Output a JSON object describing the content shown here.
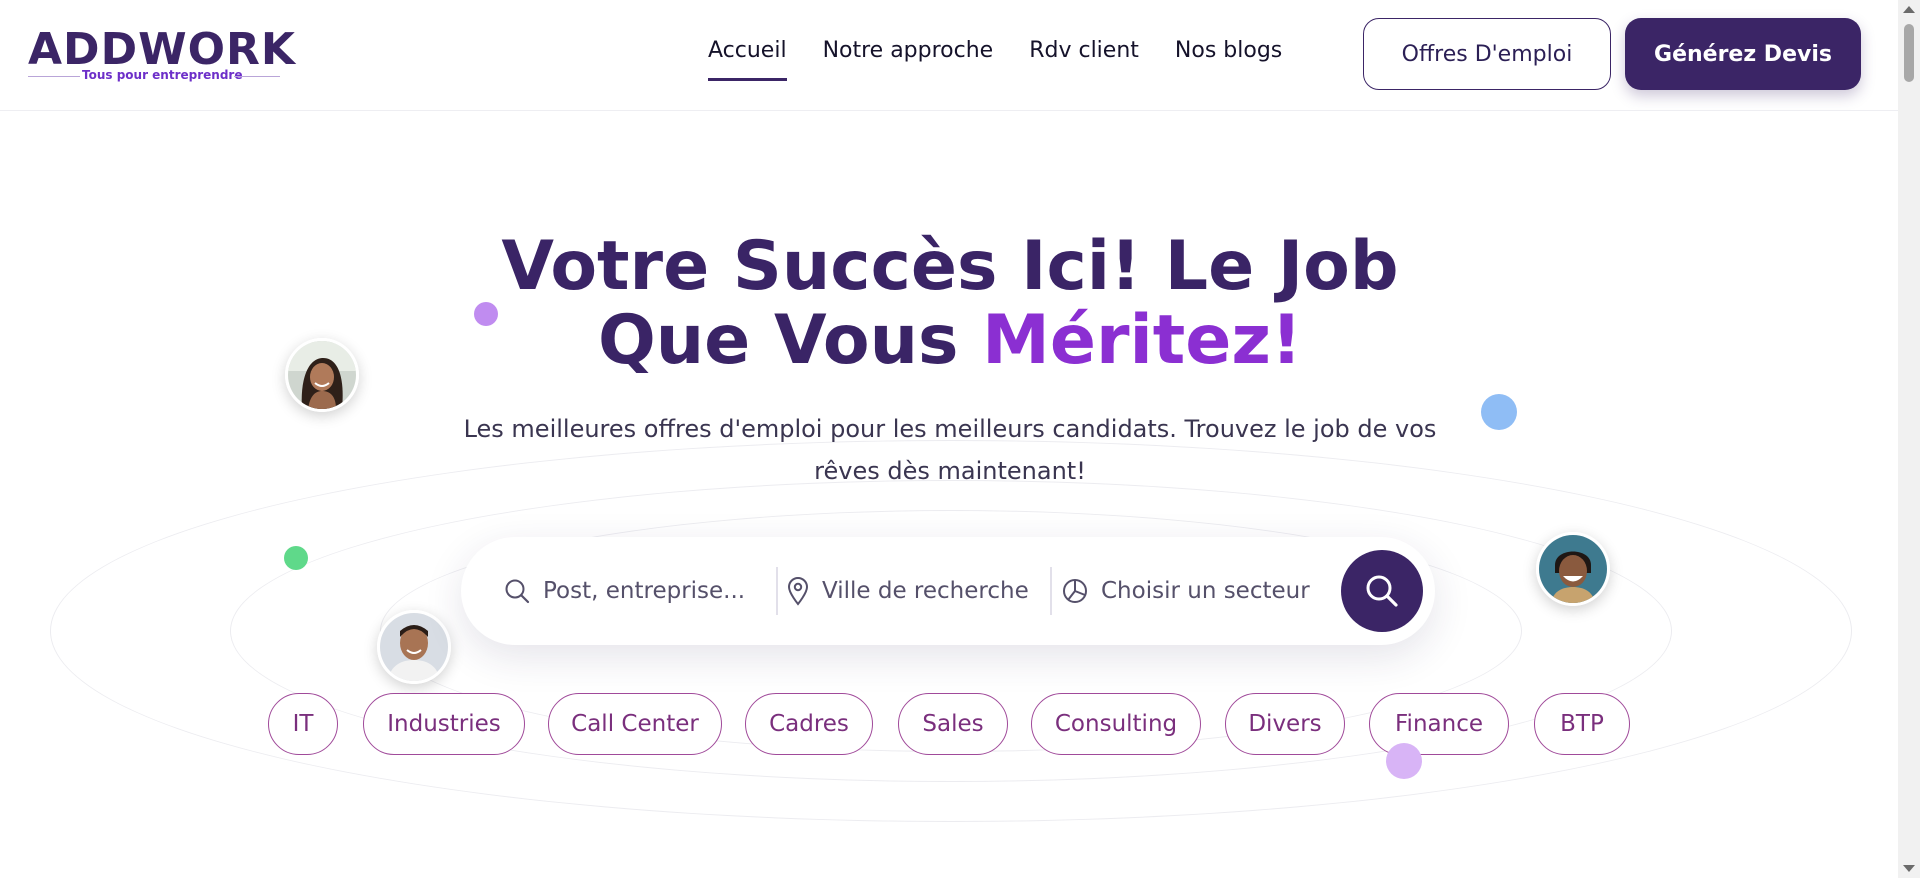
{
  "logo": {
    "name": "ADDWORK",
    "tagline": "Tous pour entreprendre"
  },
  "nav": {
    "items": [
      {
        "label": "Accueil",
        "active": true
      },
      {
        "label": "Notre approche",
        "active": false
      },
      {
        "label": "Rdv client",
        "active": false
      },
      {
        "label": "Nos blogs",
        "active": false
      }
    ],
    "jobs_button": "Offres D'emploi",
    "quote_button": "Générez Devis"
  },
  "hero": {
    "title_line1": "Votre Succès Ici! Le Job",
    "title_line2_start": "Que Vous ",
    "title_accent": "Méritez!",
    "subtitle_line1": "Les meilleures offres d'emploi pour les meilleurs candidats. Trouvez le job de vos",
    "subtitle_line2": "rêves dès maintenant!"
  },
  "search": {
    "post_placeholder": "Post, entreprise...",
    "city_placeholder": "Ville de recherche",
    "sector_placeholder": "Choisir un secteur"
  },
  "categories": [
    "IT",
    "Industries",
    "Call Center",
    "Cadres",
    "Sales",
    "Consulting",
    "Divers",
    "Finance",
    "BTP"
  ],
  "colors": {
    "brand": "#3b2566",
    "accent": "#8b2fd2",
    "chip_border": "#a04a9a",
    "dot_purple": "#c08cf0",
    "dot_blue": "#8fbdf5",
    "dot_green": "#5fd98a"
  },
  "icons": [
    "search-icon",
    "location-pin-icon",
    "pie-chart-icon"
  ]
}
